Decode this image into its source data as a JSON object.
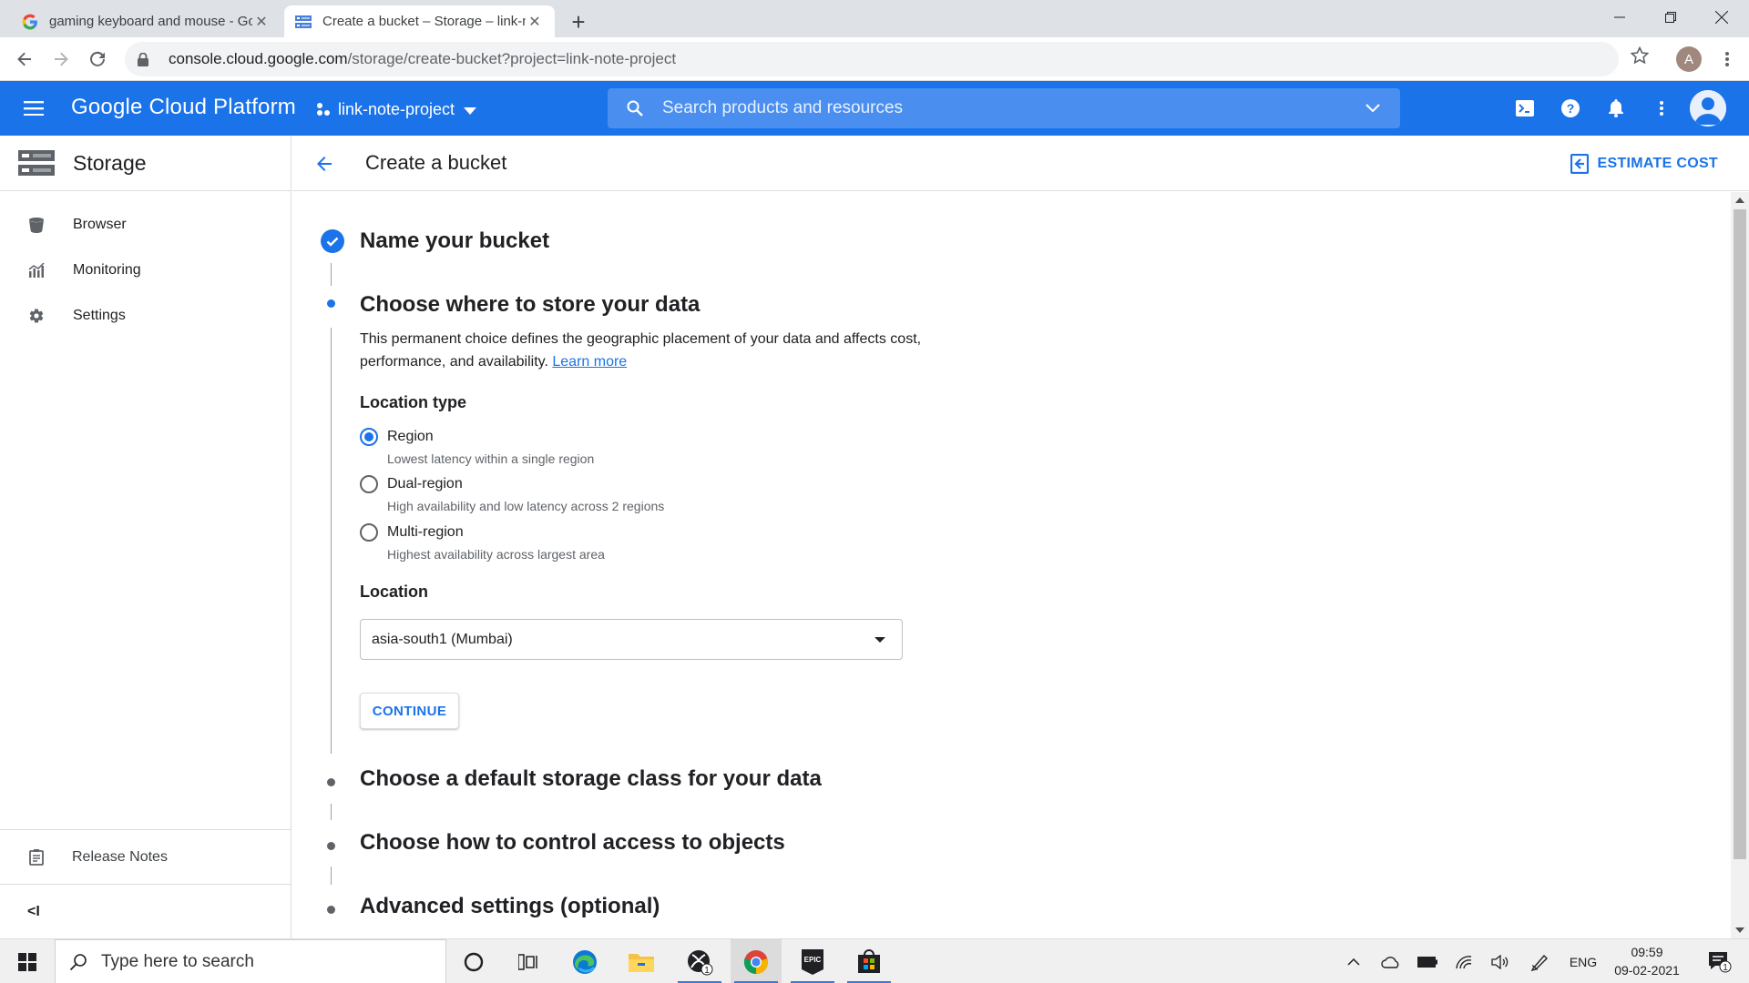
{
  "browser": {
    "tabs": [
      {
        "title": "gaming keyboard and mouse - Google Search",
        "favicon": "google-g-icon"
      },
      {
        "title": "Create a bucket – Storage – link-note-project",
        "favicon": "gcp-storage-icon"
      }
    ],
    "url_host": "console.cloud.google.com",
    "url_path": "/storage/create-bucket?project=link-note-project",
    "profile_initial": "A"
  },
  "gcp": {
    "product": "Google Cloud Platform",
    "project": "link-note-project",
    "search_placeholder": "Search products and resources",
    "brand_color": "#1a73e8"
  },
  "nav": {
    "title": "Storage",
    "items": [
      {
        "label": "Browser",
        "icon": "bucket-icon"
      },
      {
        "label": "Monitoring",
        "icon": "chart-icon"
      },
      {
        "label": "Settings",
        "icon": "gear-icon"
      }
    ],
    "release_notes": "Release Notes",
    "collapse": "<I"
  },
  "page": {
    "title": "Create a bucket",
    "estimate_cost": "ESTIMATE COST",
    "step1": "Name your bucket",
    "step2": "Choose where to store your data",
    "description": "This permanent choice defines the geographic placement of your data and affects cost, performance, and availability.",
    "learn_more": "Learn more",
    "location_type_label": "Location type",
    "location_types": [
      {
        "label": "Region",
        "sub": "Lowest latency within a single region",
        "selected": true
      },
      {
        "label": "Dual-region",
        "sub": "High availability and low latency across 2 regions",
        "selected": false
      },
      {
        "label": "Multi-region",
        "sub": "Highest availability across largest area",
        "selected": false
      }
    ],
    "location_label": "Location",
    "location_value": "asia-south1 (Mumbai)",
    "continue": "CONTINUE",
    "step3": "Choose a default storage class for your data",
    "step4": "Choose how to control access to objects",
    "step5": "Advanced settings (optional)"
  },
  "taskbar": {
    "search_placeholder": "Type here to search",
    "lang": "ENG",
    "time": "09:59",
    "date": "09-02-2021",
    "xbox_badge": "1",
    "notification_badge": "1"
  }
}
